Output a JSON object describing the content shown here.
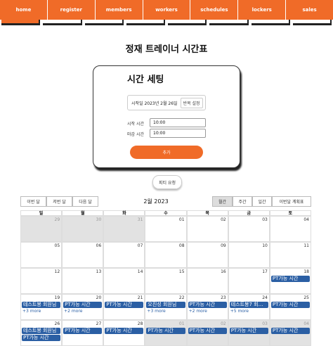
{
  "nav": {
    "items": [
      "home",
      "register",
      "members",
      "workers",
      "schedules",
      "lockers",
      "sales"
    ]
  },
  "page_title": "정재 트레이너 시간표",
  "settings": {
    "title": "시간 세팅",
    "start_date_label": "시작일 2023년 2월 26일",
    "repeat_label": "반복 설정",
    "start_time_label": "시작 시간",
    "start_time_value": "10:00",
    "end_time_label": "마감 시간",
    "end_time_value": "10:00",
    "add_button": "추가"
  },
  "pt_request_button": "피티 요청",
  "calendar": {
    "prev_month": "이번 달",
    "prev": "저번 달",
    "next": "다음 달",
    "title": "2월 2023",
    "views": [
      "월간",
      "주간",
      "일간",
      "이번달 계획표"
    ],
    "active_view": "월간",
    "weekdays": [
      "일",
      "월",
      "화",
      "수",
      "목",
      "금",
      "토"
    ],
    "weeks": [
      [
        {
          "d": "29",
          "o": true
        },
        {
          "d": "30",
          "o": true
        },
        {
          "d": "31",
          "o": true
        },
        {
          "d": "01"
        },
        {
          "d": "02"
        },
        {
          "d": "03"
        },
        {
          "d": "04"
        }
      ],
      [
        {
          "d": "05"
        },
        {
          "d": "06"
        },
        {
          "d": "07"
        },
        {
          "d": "08"
        },
        {
          "d": "09"
        },
        {
          "d": "10"
        },
        {
          "d": "11"
        }
      ],
      [
        {
          "d": "12"
        },
        {
          "d": "13"
        },
        {
          "d": "14"
        },
        {
          "d": "15"
        },
        {
          "d": "16"
        },
        {
          "d": "17"
        },
        {
          "d": "18",
          "ev": [
            "PT가능 시간"
          ]
        }
      ],
      [
        {
          "d": "19",
          "ev": [
            "테스트봉 회원님"
          ],
          "more": "+3 more"
        },
        {
          "d": "20",
          "ev": [
            "PT가능 시간"
          ],
          "more": "+2 more"
        },
        {
          "d": "21",
          "ev": [
            "PT가능 시간"
          ]
        },
        {
          "d": "22",
          "ev": [
            "오진성 회원님"
          ],
          "more": "+3 more"
        },
        {
          "d": "23",
          "ev": [
            "PT가능 시간"
          ],
          "more": "+2 more"
        },
        {
          "d": "24",
          "ev": [
            "테스트봉7 회…"
          ],
          "more": "+5 more"
        },
        {
          "d": "25",
          "ev": [
            "PT가능 시간"
          ]
        }
      ],
      [
        {
          "d": "26",
          "ev": [
            "테스트봉 회원님",
            "PT가능 시간"
          ]
        },
        {
          "d": "27",
          "ev": [
            "PT가능 시간"
          ]
        },
        {
          "d": "28",
          "ev": [
            "PT가능 시간"
          ]
        },
        {
          "d": "01",
          "o": true,
          "ev": [
            "PT가능 시간"
          ]
        },
        {
          "d": "02",
          "o": true,
          "ev": [
            "PT가능 시간"
          ]
        },
        {
          "d": "03",
          "o": true,
          "ev": [
            "PT가능 시간"
          ]
        },
        {
          "d": "04",
          "o": true,
          "ev": [
            "PT가능 시간"
          ]
        }
      ]
    ]
  },
  "colors": {
    "accent": "#f06b28",
    "event": "#2b5fa4"
  }
}
